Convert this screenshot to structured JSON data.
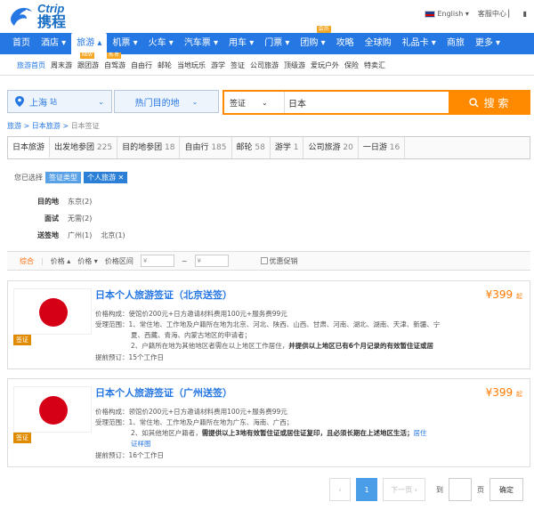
{
  "header": {
    "logo_text": "Ctrip",
    "logo_cn": "携程",
    "language": "English ▾",
    "service": "客服中心 ▏",
    "cart": "▮"
  },
  "nav": [
    {
      "label": "首页"
    },
    {
      "label": "酒店 ▾"
    },
    {
      "label": "旅游 ▴"
    },
    {
      "label": "机票 ▾"
    },
    {
      "label": "火车 ▾"
    },
    {
      "label": "汽车票 ▾"
    },
    {
      "label": "用车 ▾"
    },
    {
      "label": "门票 ▾"
    },
    {
      "label": "团购 ▾",
      "badge": "会员"
    },
    {
      "label": "攻略"
    },
    {
      "label": "全球购"
    },
    {
      "label": "礼品卡 ▾"
    },
    {
      "label": "商旅"
    },
    {
      "label": "更多 ▾"
    }
  ],
  "subnav": [
    "旅游首页",
    "周末游",
    "跟团游",
    "自驾游",
    "自由行",
    "邮轮",
    "当地玩乐",
    "游学",
    "签证",
    "公司旅游",
    "顶级游",
    "爱玩户外",
    "保险",
    "特卖汇"
  ],
  "subnav_badges": {
    "new": "NEW",
    "hot": "热·荐"
  },
  "search": {
    "city": "上海",
    "city_suffix": "站",
    "dest": "热门目的地",
    "type": "签证",
    "query": "日本",
    "button": "搜 索"
  },
  "breadcrumb": {
    "a": "旅游",
    "b": "日本旅游",
    "c": "日本签证"
  },
  "tabs": [
    {
      "label": "日本旅游",
      "count": ""
    },
    {
      "label": "出发地参团",
      "count": "225"
    },
    {
      "label": "目的地参团",
      "count": "18"
    },
    {
      "label": "自由行",
      "count": "185"
    },
    {
      "label": "邮轮",
      "count": "58"
    },
    {
      "label": "游学",
      "count": "1"
    },
    {
      "label": "公司旅游",
      "count": "20"
    },
    {
      "label": "一日游",
      "count": "16"
    }
  ],
  "filter": {
    "label": "您已选择",
    "chip1": "签证类型",
    "chip2": "个人旅游 ✕"
  },
  "filters": [
    {
      "key": "目的地",
      "values": [
        "东京(2)"
      ]
    },
    {
      "key": "面试",
      "values": [
        "无需(2)"
      ]
    },
    {
      "key": "送签地",
      "values": [
        "广州(1)",
        "北京(1)"
      ]
    }
  ],
  "sort": {
    "all": "综合",
    "sep": "|",
    "price_up": "价格 ▴",
    "price_down": "价格 ▾",
    "range": "价格区间",
    "min": "¥",
    "tilde": "~",
    "max": "¥",
    "promo": "优惠促销"
  },
  "cards": [
    {
      "title": "日本个人旅游签证（北京送签）",
      "price": "399",
      "price_prefix": "¥",
      "price_suffix": "起",
      "tag": "签证",
      "l1_k": "价格构成：",
      "l1_v": "使馆价200元+日方邀请材料费用100元+服务费99元",
      "l2_k": "受理范围：",
      "l2_v": "1、常住地、工作地及户籍所在地为北京、河北、陕西、山西、甘肃、河南、湖北、湖南、天津、新疆、宁",
      "l3_v": "夏、西藏、青海、内蒙古地区的申请者；",
      "l4_v": "2、户籍所在地为其他地区者需在以上地区工作居住，",
      "l4_b": "并提供以上地区已有6个月记录的有效暂住证或居",
      "l5_k": "提前预订：",
      "l5_v": "15个工作日"
    },
    {
      "title": "日本个人旅游签证（广州送签）",
      "price": "399",
      "price_prefix": "¥",
      "price_suffix": "起",
      "tag": "签证",
      "l1_k": "价格构成：",
      "l1_v": "领馆价200元+日方邀请材料费用100元+服务费99元",
      "l2_k": "受理范围：",
      "l2_v": "1、常住地、工作地及户籍所在地为广东、海南、广西；",
      "l3_v": "2、如其他地区户籍者，",
      "l3_b": "需提供以上3地有效暂住证或居住证复印，且必须长期在上述地区生活；",
      "l3_link": "居住",
      "l4_v": "证样图",
      "l5_k": "提前预订：",
      "l5_v": "16个工作日"
    }
  ],
  "pager": {
    "prev": "‹",
    "current": "1",
    "next": "下一页 ›",
    "goto": "到",
    "page": "页",
    "ok": "确定"
  },
  "colors": {
    "brand": "#2577e3",
    "accent": "#ff8a00",
    "price": "#ff7a00"
  }
}
